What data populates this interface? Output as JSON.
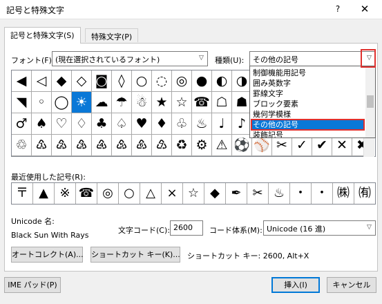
{
  "window": {
    "title": "記号と特殊文字",
    "help": "?",
    "close": "✕"
  },
  "tabs": [
    {
      "label": "記号と特殊文字(S)"
    },
    {
      "label": "特殊文字(P)"
    }
  ],
  "font": {
    "label": "フォント(F):",
    "value": "(現在選択されているフォント)"
  },
  "subset": {
    "label": "種類(U):",
    "value": "その他の記号"
  },
  "subset_dropdown": {
    "items": [
      "制御機能用記号",
      "囲み英数字",
      "罫線文字",
      "ブロック要素",
      "幾何学模様",
      "その他の記号",
      "装飾記号"
    ],
    "highlighted_index": 5
  },
  "symbol_grid": [
    [
      "◀",
      "◁",
      "◆",
      "◇",
      "◙",
      "◊",
      "○",
      "◌",
      "◎",
      "●",
      "◐",
      "◑",
      "◒",
      "◓",
      "◔",
      "◕",
      "◖",
      "◗"
    ],
    [
      "◥",
      "◦",
      "◯",
      "☀",
      "☁",
      "☂",
      "☃",
      "★",
      "☆",
      "☎",
      "☖",
      "☗",
      "☘",
      "☙",
      "☚",
      "☛",
      "☜",
      "☝"
    ],
    [
      "♂",
      "♠",
      "♡",
      "♢",
      "♣",
      "♤",
      "♥",
      "♦",
      "♧",
      "♨",
      "♩",
      "♪",
      "♫",
      "♬",
      "♭",
      "♮",
      "♯",
      "♰"
    ],
    [
      "♲",
      "♳",
      "♴",
      "♵",
      "♶",
      "♷",
      "♸",
      "♹",
      "♻",
      "⚙",
      "⚠",
      "⚽",
      "⚾",
      "✂",
      "✓",
      "✔",
      "✕",
      "✖"
    ]
  ],
  "selected_cell": {
    "row": 1,
    "col": 3
  },
  "recent": {
    "label": "最近使用した記号(R):",
    "symbols": [
      "〒",
      "▲",
      "※",
      "☎",
      "◎",
      "○",
      "△",
      "×",
      "☆",
      "◆",
      "✒",
      "✂",
      "♨",
      "・",
      "・",
      "㈱",
      "㈲"
    ]
  },
  "unicode_name": {
    "label": "Unicode 名:",
    "value": "Black Sun With Rays"
  },
  "char_code": {
    "label": "文字コード(C):",
    "value": "2600"
  },
  "code_system": {
    "label": "コード体系(M):",
    "value": "Unicode (16 進)"
  },
  "buttons": {
    "autocorrect": "オートコレクト(A)...",
    "shortcut_key": "ショートカット キー(K)...",
    "ime_pad": "IME パッド(P)",
    "insert": "挿入(I)",
    "cancel": "キャンセル"
  },
  "shortcut_text": "ショートカット キー: 2600, Alt+X"
}
